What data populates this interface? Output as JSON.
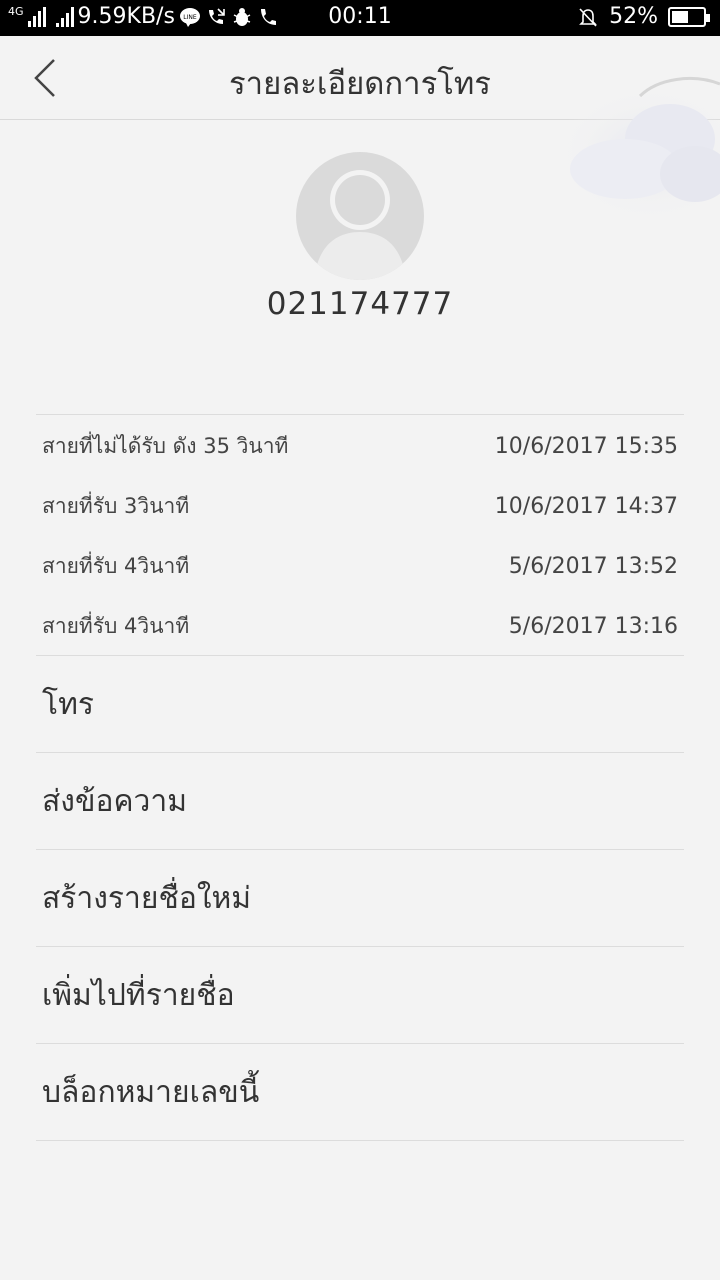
{
  "status_bar": {
    "network": "4G",
    "speed": "9.59KB/s",
    "time": "00:11",
    "battery": "52%",
    "battery_level": 0.52
  },
  "header": {
    "title": "รายละเอียดการโทร"
  },
  "contact": {
    "phone_number": "021174777"
  },
  "call_log": [
    {
      "type": "สายที่ไม่ได้รับ ดัง 35 วินาที",
      "datetime": "10/6/2017 15:35"
    },
    {
      "type": "สายที่รับ  3วินาที",
      "datetime": "10/6/2017 14:37"
    },
    {
      "type": "สายที่รับ  4วินาที",
      "datetime": "5/6/2017 13:52"
    },
    {
      "type": "สายที่รับ  4วินาที",
      "datetime": "5/6/2017 13:16"
    }
  ],
  "actions": {
    "call": "โทร",
    "message": "ส่งข้อความ",
    "create_contact": "สร้างรายชื่อใหม่",
    "add_to_contact": "เพิ่มไปที่รายชื่อ",
    "block_number": "บล็อกหมายเลขนี้"
  }
}
